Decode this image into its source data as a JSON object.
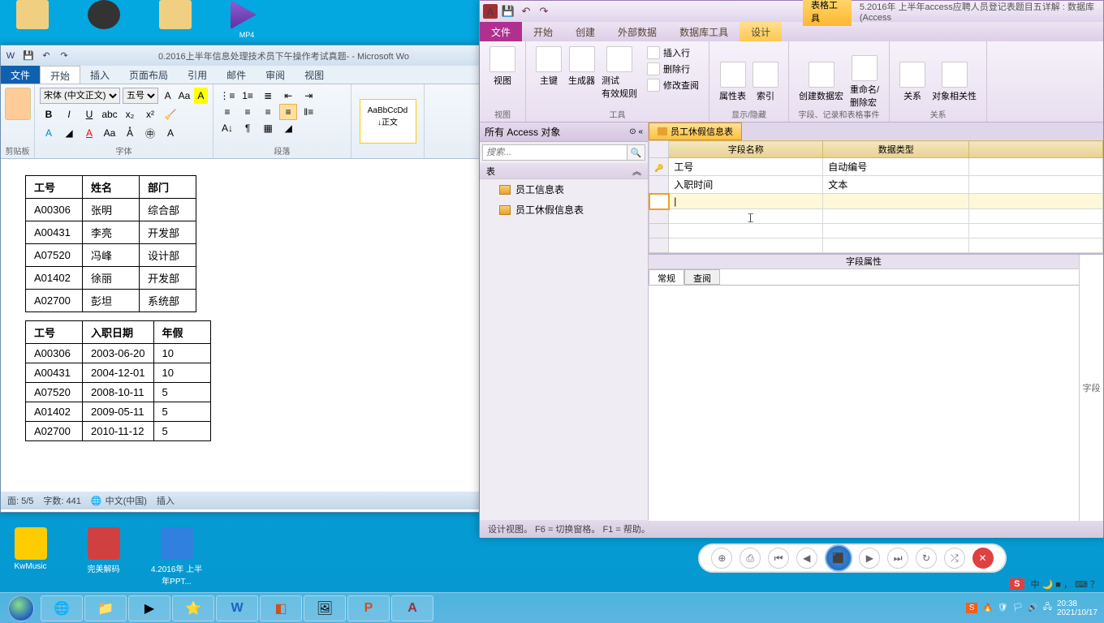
{
  "desktop_icons": [
    "",
    "",
    "",
    "MP4"
  ],
  "desktop_row2": [
    "KwMusic",
    "完美解码",
    "4.2016年 上半年PPT..."
  ],
  "word": {
    "title": "0.2016上半年信息处理技术员下午操作考试真题- - Microsoft Wo",
    "tabs": {
      "file": "文件",
      "active": "开始",
      "others": [
        "插入",
        "页面布局",
        "引用",
        "邮件",
        "审阅",
        "视图"
      ]
    },
    "ribbon": {
      "clipboard": "剪贴板",
      "font": "字体",
      "font_name": "宋体 (中文正文)",
      "font_size": "五号",
      "paragraph": "段落",
      "style_sample": "AaBbCcDd",
      "style_name": "↓正文"
    },
    "table1": {
      "headers": [
        "工号",
        "姓名",
        "部门"
      ],
      "rows": [
        [
          "A00306",
          "张明",
          "综合部"
        ],
        [
          "A00431",
          "李亮",
          "开发部"
        ],
        [
          "A07520",
          "冯峰",
          "设计部"
        ],
        [
          "A01402",
          "徐丽",
          "开发部"
        ],
        [
          "A02700",
          "彭坦",
          "系统部"
        ]
      ]
    },
    "table2": {
      "headers": [
        "工号",
        "入职日期",
        "年假"
      ],
      "rows": [
        [
          "A00306",
          "2003-06-20",
          "10"
        ],
        [
          "A00431",
          "2004-12-01",
          "10"
        ],
        [
          "A07520",
          "2008-10-11",
          "5"
        ],
        [
          "A01402",
          "2009-05-11",
          "5"
        ],
        [
          "A02700",
          "2010-11-12",
          "5"
        ]
      ]
    },
    "status": {
      "page": "面: 5/5",
      "words": "字数: 441",
      "lang": "中文(中国)",
      "mode": "插入"
    }
  },
  "access": {
    "title": "5.2016年 上半年access应聘人员登记表题目五详解 : 数据库 (Access",
    "tool_context": "表格工具",
    "tabs": {
      "file": "文件",
      "others": [
        "开始",
        "创建",
        "外部数据",
        "数据库工具"
      ],
      "ctx": "设计"
    },
    "ribbon": {
      "view": "视图",
      "view_lbl": "视图",
      "pk": "主键",
      "builder": "生成器",
      "test": "测试\n有效规则",
      "tools_lbl": "工具",
      "insert": "插入行",
      "delete": "删除行",
      "modify": "修改查阅",
      "propsheet": "属性表",
      "index": "索引",
      "showhide_lbl": "显示/隐藏",
      "macro": "创建数据宏",
      "rename": "重命名/\n删除宏",
      "events_lbl": "字段、记录和表格事件",
      "rel": "关系",
      "deps": "对象相关性",
      "rel_lbl": "关系"
    },
    "nav": {
      "header": "所有 Access 对象",
      "search_ph": "搜索...",
      "group": "表",
      "items": [
        "员工信息表",
        "员工休假信息表"
      ]
    },
    "design": {
      "tab": "员工休假信息表",
      "col_field": "字段名称",
      "col_type": "数据类型",
      "fields": [
        {
          "name": "工号",
          "type": "自动编号",
          "pk": true
        },
        {
          "name": "入职时间",
          "type": "文本"
        }
      ]
    },
    "props": {
      "header": "字段属性",
      "tab_general": "常规",
      "tab_lookup": "查阅",
      "hint": "字段"
    },
    "status": "设计视图。   F6 = 切换窗格。   F1 = 帮助。"
  },
  "time": {
    "clock": "20:38",
    "date": "2021/10/17"
  },
  "ime": {
    "s": "S",
    "chars": "中 🌙 ■ ，  ⌨ ？"
  }
}
